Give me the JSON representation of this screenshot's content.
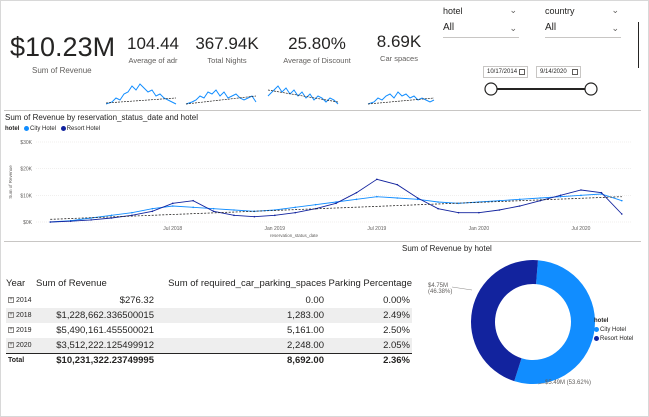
{
  "kpis": {
    "revenue": {
      "value": "$10.23M",
      "label": "Sum of Revenue"
    },
    "cards": [
      {
        "value": "104.44",
        "label": "Average of adr"
      },
      {
        "value": "367.94K",
        "label": "Total Nights"
      },
      {
        "value": "25.80%",
        "label": "Average of Discount"
      },
      {
        "value": "8.69K",
        "label": "Car spaces"
      }
    ]
  },
  "slicers": {
    "hotel": {
      "label": "hotel",
      "value": "All"
    },
    "country": {
      "label": "country",
      "value": "All"
    },
    "date_start": "10/17/2014",
    "date_end": "9/14/2020"
  },
  "line_chart": {
    "title": "Sum of Revenue by reservation_status_date and hotel",
    "legend_title": "hotel",
    "xlabel": "reservation_status_date",
    "ylabel": "Sum of Revenue"
  },
  "table": {
    "headers": [
      "Year",
      "Sum of Revenue",
      "Sum of required_car_parking_spaces",
      "Parking Percentage"
    ],
    "rows": [
      {
        "year": "2014",
        "revenue": "$276.32",
        "parking": "0.00",
        "pct": "0.00%"
      },
      {
        "year": "2018",
        "revenue": "$1,228,662.336500015",
        "parking": "1,283.00",
        "pct": "2.49%"
      },
      {
        "year": "2019",
        "revenue": "$5,490,161.455500021",
        "parking": "5,161.00",
        "pct": "2.50%"
      },
      {
        "year": "2020",
        "revenue": "$3,512,222.125499912",
        "parking": "2,248.00",
        "pct": "2.05%"
      }
    ],
    "total": {
      "label": "Total",
      "revenue": "$10,231,322.23749995",
      "parking": "8,692.00",
      "pct": "2.36%"
    }
  },
  "donut": {
    "title": "Sum of Revenue by hotel",
    "legend_title": "hotel",
    "label_resort_value": "$4.75M",
    "label_resort_pct": "(46.38%)",
    "label_city": "$5.49M (53.62%)"
  },
  "colors": {
    "city": "#118dff",
    "resort": "#12239e"
  },
  "chart_data": [
    {
      "type": "line",
      "title": "Sum of Revenue by reservation_status_date and hotel",
      "xlabel": "reservation_status_date",
      "ylabel": "Sum of Revenue",
      "ylim": [
        0,
        30000
      ],
      "y_ticks": [
        "$0K",
        "$10K",
        "$20K",
        "$30K"
      ],
      "x_ticks": [
        "Jul 2018",
        "Jan 2019",
        "Jul 2019",
        "Jan 2020",
        "Jul 2020"
      ],
      "x_tick_values": [
        2018.5,
        2019.0,
        2019.5,
        2020.0,
        2020.5
      ],
      "xlim": [
        2017.83,
        2020.75
      ],
      "series": [
        {
          "name": "City Hotel",
          "color": "#118dff",
          "x": [
            2017.9,
            2018.0,
            2018.1,
            2018.2,
            2018.3,
            2018.4,
            2018.5,
            2018.6,
            2018.7,
            2018.8,
            2018.9,
            2019.0,
            2019.1,
            2019.2,
            2019.3,
            2019.4,
            2019.5,
            2019.6,
            2019.7,
            2019.8,
            2019.9,
            2020.0,
            2020.1,
            2020.2,
            2020.3,
            2020.4,
            2020.5,
            2020.6,
            2020.7
          ],
          "values": [
            0,
            500,
            1500,
            2500,
            3500,
            5000,
            6000,
            5500,
            5000,
            4500,
            4000,
            4500,
            5500,
            6500,
            7500,
            8500,
            9500,
            9000,
            8500,
            7500,
            7000,
            7500,
            8000,
            8500,
            9000,
            9500,
            10000,
            10500,
            8000
          ]
        },
        {
          "name": "Resort Hotel",
          "color": "#12239e",
          "x": [
            2017.9,
            2018.0,
            2018.1,
            2018.2,
            2018.3,
            2018.4,
            2018.5,
            2018.6,
            2018.7,
            2018.8,
            2018.9,
            2019.0,
            2019.1,
            2019.2,
            2019.3,
            2019.4,
            2019.5,
            2019.6,
            2019.7,
            2019.8,
            2019.9,
            2020.0,
            2020.1,
            2020.2,
            2020.3,
            2020.4,
            2020.5,
            2020.6,
            2020.7
          ],
          "values": [
            0,
            300,
            800,
            1500,
            2500,
            4000,
            7000,
            8000,
            4000,
            2500,
            2000,
            2500,
            3500,
            5000,
            7000,
            11000,
            16000,
            14000,
            9000,
            5000,
            3500,
            3500,
            4500,
            6000,
            8000,
            10000,
            12000,
            11000,
            3000
          ]
        }
      ],
      "trendline": {
        "style": "dashed",
        "color": "#252423",
        "from": [
          2017.9,
          1000
        ],
        "to": [
          2020.7,
          9500
        ]
      }
    },
    {
      "type": "pie",
      "title": "Sum of Revenue by hotel",
      "categories": [
        "City Hotel",
        "Resort Hotel"
      ],
      "values": [
        5.49,
        4.75
      ],
      "percent": [
        53.62,
        46.38
      ],
      "colors": [
        "#118dff",
        "#12239e"
      ],
      "donut": true,
      "legend": "right"
    }
  ]
}
